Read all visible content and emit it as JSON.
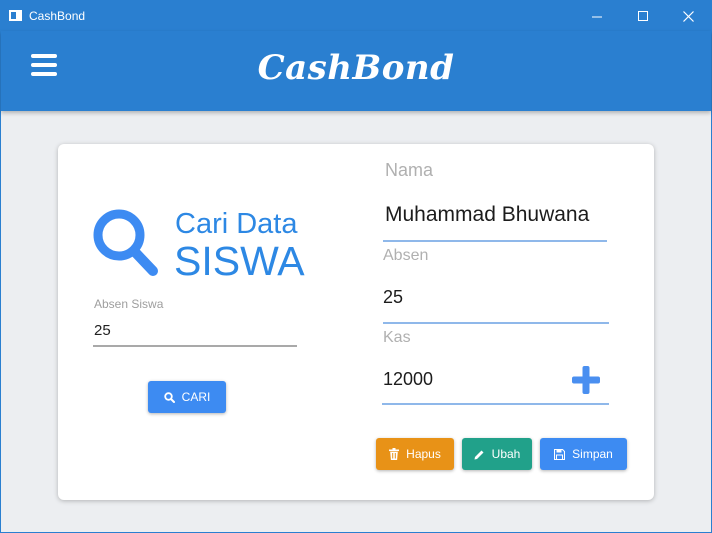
{
  "window": {
    "title": "CashBond",
    "titlebar_color": "#2a7fd0"
  },
  "header": {
    "brand": "CashBond",
    "menu_icon": "hamburger-menu-icon"
  },
  "search_panel": {
    "icon": "search-icon",
    "title_line1": "Cari Data",
    "title_line2": "SISWA",
    "field_label": "Absen Siswa",
    "field_value": "25",
    "button_label": "CARI",
    "accent": "#2d88e4"
  },
  "detail_panel": {
    "nama_label": "Nama",
    "nama_value": "Muhammad Bhuwana",
    "absen_label": "Absen",
    "absen_value": "25",
    "kas_label": "Kas",
    "kas_value": "12000",
    "add_icon": "plus-icon"
  },
  "actions": {
    "hapus_label": "Hapus",
    "ubah_label": "Ubah",
    "simpan_label": "Simpan",
    "hapus_color": "#e89217",
    "ubah_color": "#21a18a",
    "simpan_color": "#3d8bf2"
  }
}
